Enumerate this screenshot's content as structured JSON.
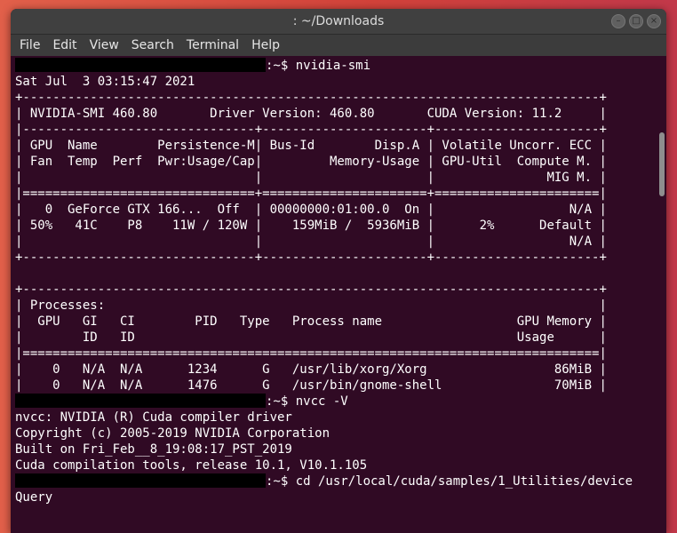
{
  "window": {
    "title": ": ~/Downloads",
    "controls": [
      "–",
      "□",
      "×"
    ]
  },
  "menu": [
    "File",
    "Edit",
    "View",
    "Search",
    "Terminal",
    "Help"
  ],
  "terminal": {
    "lines": [
      {
        "prompt": true,
        "text": ":~$ nvidia-smi"
      },
      {
        "text": "Sat Jul  3 03:15:47 2021"
      },
      {
        "text": "+-----------------------------------------------------------------------------+"
      },
      {
        "text": "| NVIDIA-SMI 460.80       Driver Version: 460.80       CUDA Version: 11.2     |"
      },
      {
        "text": "|-------------------------------+----------------------+----------------------+"
      },
      {
        "text": "| GPU  Name        Persistence-M| Bus-Id        Disp.A | Volatile Uncorr. ECC |"
      },
      {
        "text": "| Fan  Temp  Perf  Pwr:Usage/Cap|         Memory-Usage | GPU-Util  Compute M. |"
      },
      {
        "text": "|                               |                      |               MIG M. |"
      },
      {
        "text": "|===============================+======================+======================|"
      },
      {
        "text": "|   0  GeForce GTX 166...  Off  | 00000000:01:00.0  On |                  N/A |"
      },
      {
        "text": "| 50%   41C    P8    11W / 120W |    159MiB /  5936MiB |      2%      Default |"
      },
      {
        "text": "|                               |                      |                  N/A |"
      },
      {
        "text": "+-------------------------------+----------------------+----------------------+"
      },
      {
        "text": ""
      },
      {
        "text": "+-----------------------------------------------------------------------------+"
      },
      {
        "text": "| Processes:                                                                  |"
      },
      {
        "text": "|  GPU   GI   CI        PID   Type   Process name                  GPU Memory |"
      },
      {
        "text": "|        ID   ID                                                   Usage      |"
      },
      {
        "text": "|=============================================================================|"
      },
      {
        "text": "|    0   N/A  N/A      1234      G   /usr/lib/xorg/Xorg                 86MiB |"
      },
      {
        "text": "|    0   N/A  N/A      1476      G   /usr/bin/gnome-shell               70MiB |"
      },
      {
        "prompt": true,
        "text": ":~$ nvcc -V"
      },
      {
        "text": "nvcc: NVIDIA (R) Cuda compiler driver"
      },
      {
        "text": "Copyright (c) 2005-2019 NVIDIA Corporation"
      },
      {
        "text": "Built on Fri_Feb__8_19:08:17_PST_2019"
      },
      {
        "text": "Cuda compilation tools, release 10.1, V10.1.105"
      },
      {
        "prompt": true,
        "text": ":~$ cd /usr/local/cuda/samples/1_Utilities/device"
      },
      {
        "text": "Query"
      }
    ]
  }
}
